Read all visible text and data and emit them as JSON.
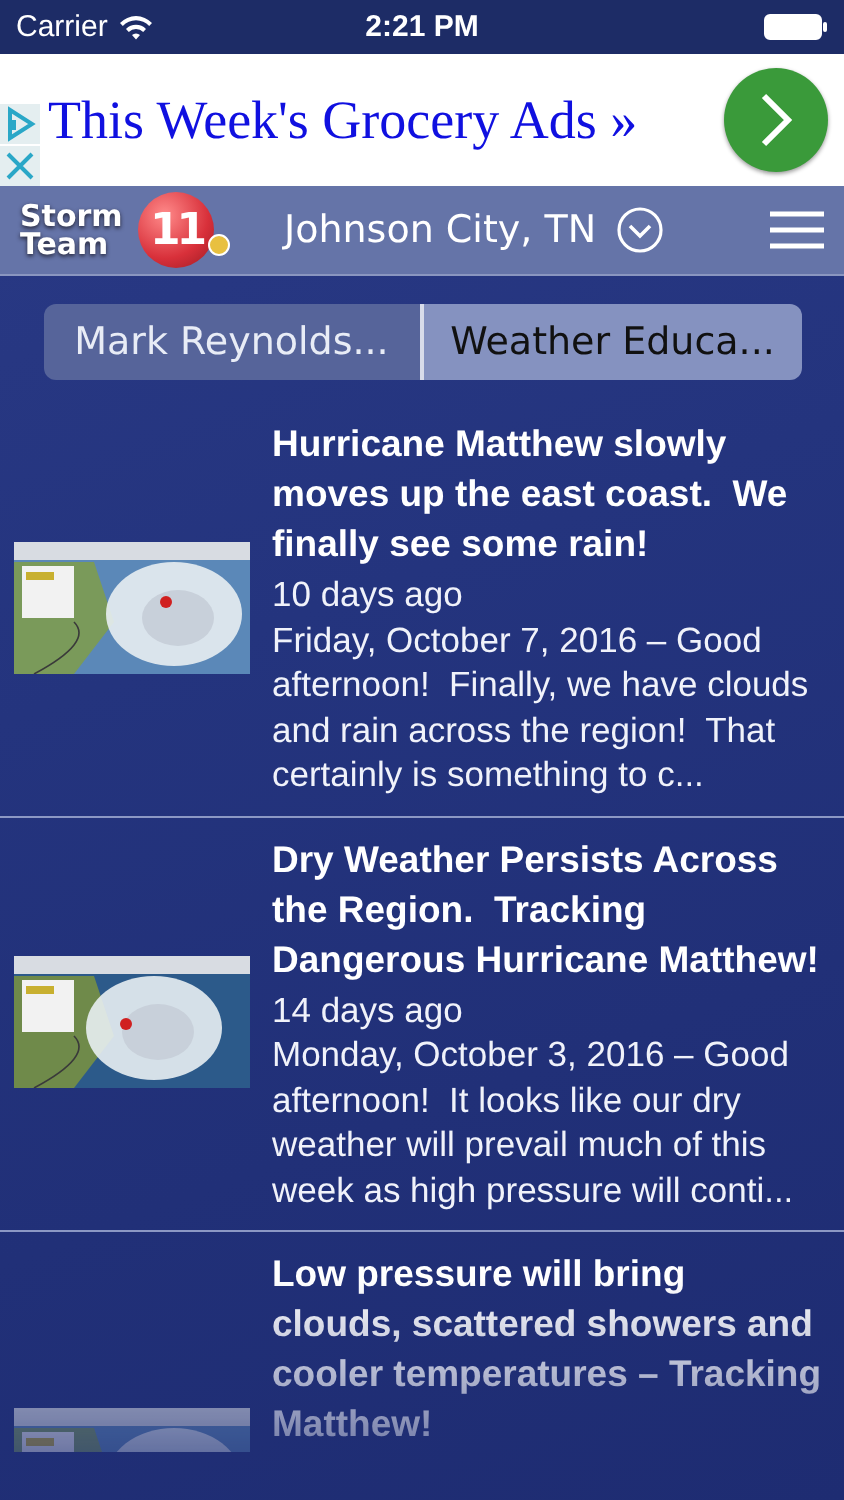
{
  "status_bar": {
    "carrier": "Carrier",
    "time": "2:21 PM"
  },
  "ad": {
    "text": "This Week's Grocery Ads »"
  },
  "header": {
    "logo": {
      "line1": "Storm",
      "line2": "Team",
      "number": "11"
    },
    "location": "Johnson City, TN"
  },
  "tabs": [
    {
      "label": "Mark Reynolds...",
      "selected": false
    },
    {
      "label": "Weather Educa...",
      "selected": true
    }
  ],
  "articles": [
    {
      "title": "Hurricane Matthew slowly moves up the east coast.  We finally see some rain!",
      "age": "10 days ago",
      "summary": "Friday, October 7, 2016 – Good afternoon!  Finally, we have clouds and rain across the region!  That certainly is something to c...",
      "faded": false
    },
    {
      "title": "Dry Weather Persists Across the Region.  Tracking Dangerous Hurricane Matthew!",
      "age": "14 days ago",
      "summary": "Monday, October 3, 2016 – Good afternoon!  It looks like our dry weather will prevail much of this week as high pressure will conti...",
      "faded": false
    },
    {
      "title": "Low pressure will bring clouds, scattered showers and cooler temperatures – Tracking Matthew!",
      "faded": true
    }
  ]
}
